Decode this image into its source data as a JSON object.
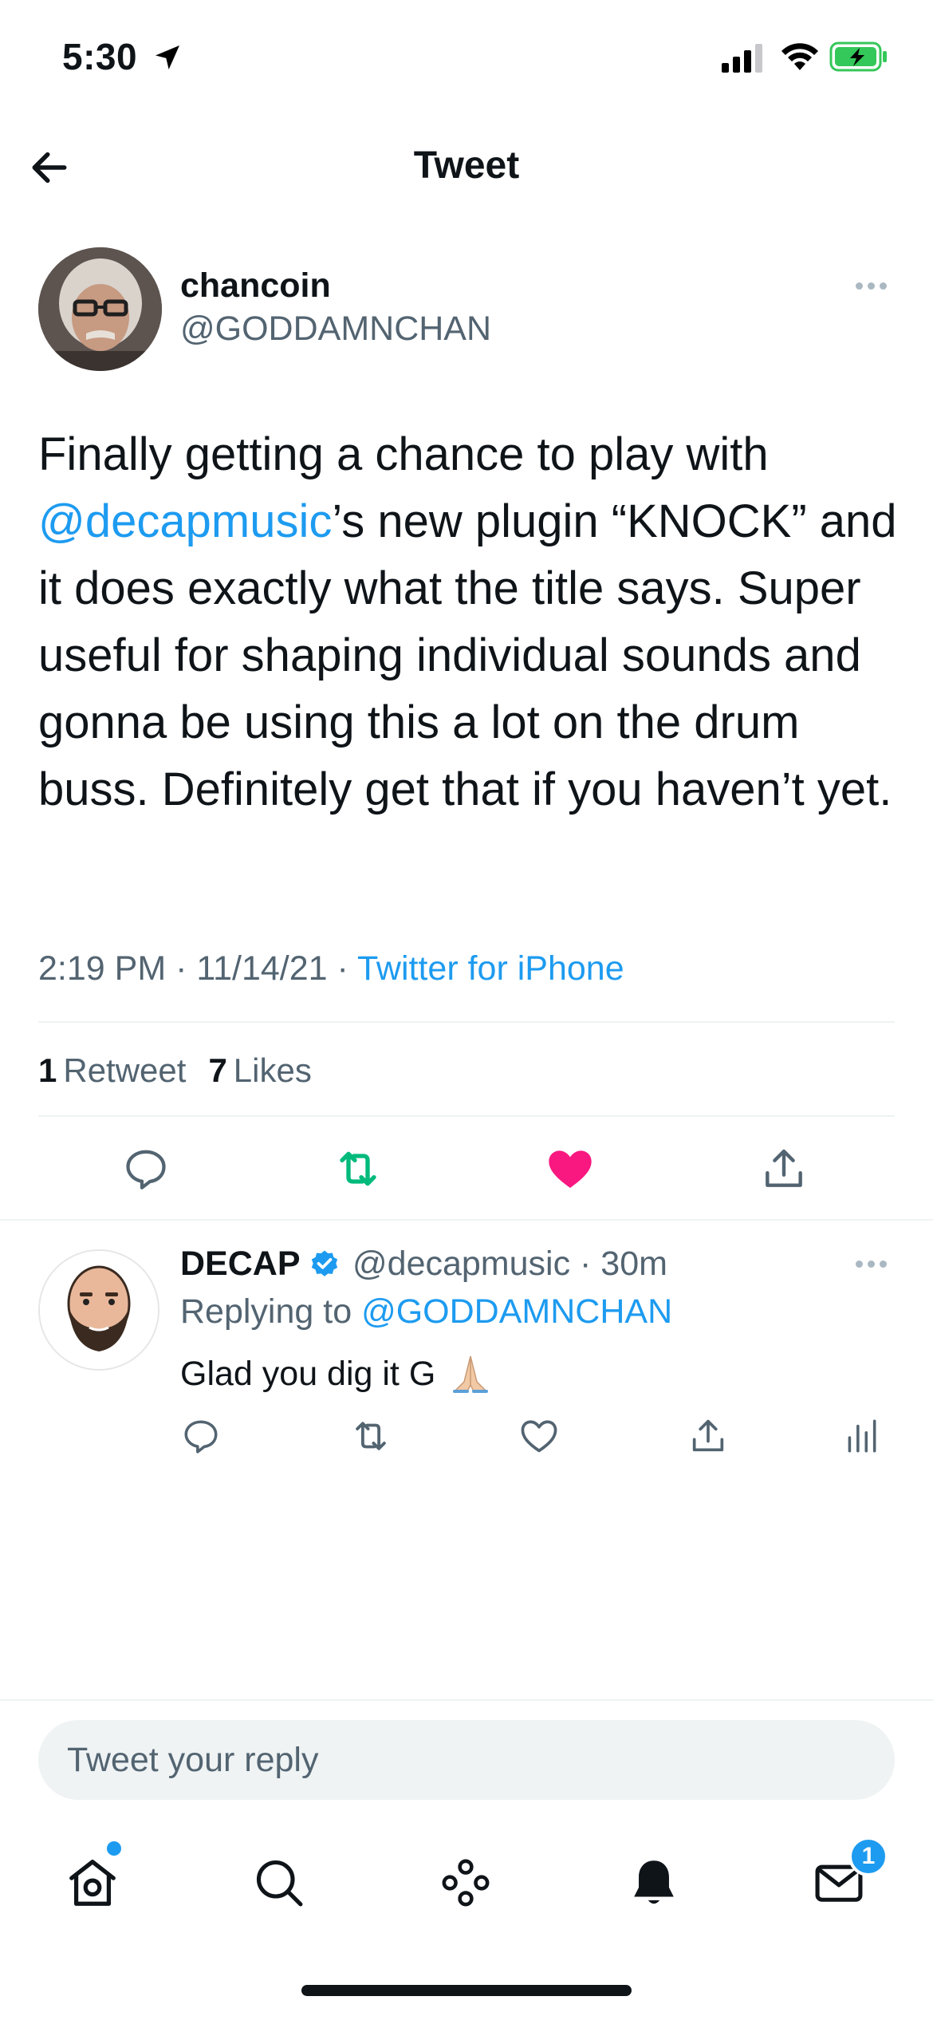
{
  "status_bar": {
    "time": "5:30",
    "icons": [
      "location-arrow-icon",
      "cellular-signal-icon",
      "wifi-icon",
      "battery-charging-icon"
    ]
  },
  "header": {
    "title": "Tweet",
    "back_icon": "arrow-left-icon"
  },
  "tweet": {
    "author_name": "chancoin",
    "author_handle": "@GODDAMNCHAN",
    "text_before_mention": "Finally getting a chance to play with ",
    "mention": "@decapmusic",
    "text_after_mention": "’s new plugin “KNOCK” and it does exactly what the title says. Super useful for shaping individual sounds and gonna be using this a lot on the drum buss. Definitely get that if you haven’t yet.",
    "time": "2:19 PM",
    "date": "11/14/21",
    "separator": "·",
    "source": "Twitter for iPhone",
    "retweet_count": "1",
    "retweet_label": "Retweet",
    "like_count": "7",
    "like_label": "Likes",
    "liked": true,
    "colors": {
      "retweet": "#00ba7c",
      "like": "#f91880",
      "link": "#1d9bf0"
    }
  },
  "reply": {
    "author_name": "DECAP",
    "verified": true,
    "handle_time": "@decapmusic · 30m",
    "replying_to_label": "Replying to ",
    "replying_to_handle": "@GODDAMNCHAN",
    "text": "Glad you dig it G",
    "emoji": "folded-hands-emoji"
  },
  "compose": {
    "placeholder": "Tweet your reply"
  },
  "tab_bar": {
    "items": [
      "home-icon",
      "search-icon",
      "spaces-icon",
      "notifications-icon",
      "messages-icon"
    ],
    "messages_badge": "1"
  }
}
